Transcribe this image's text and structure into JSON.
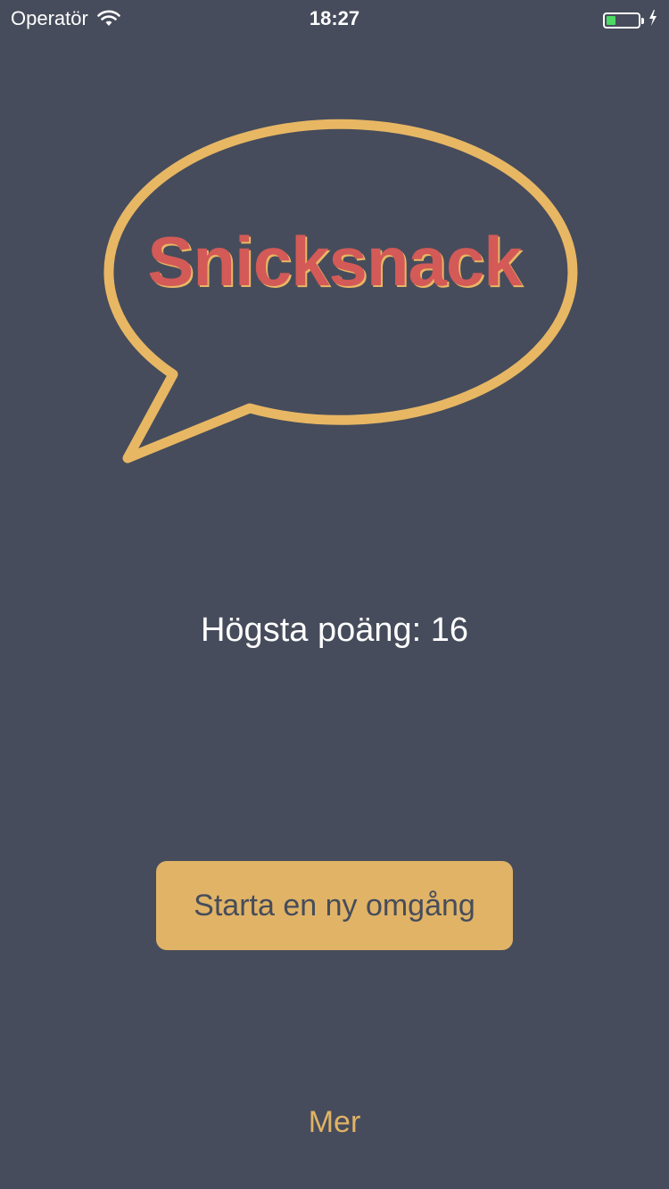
{
  "status_bar": {
    "carrier": "Operatör",
    "time": "18:27",
    "battery_level": 0.28,
    "battery_color": "#4cd964",
    "charging": true,
    "wifi_icon": "wifi-icon",
    "charging_icon": "bolt-icon"
  },
  "logo": {
    "title": "Snicksnack",
    "bubble_icon": "speech-bubble-icon"
  },
  "high_score": "Högsta poäng: 16",
  "start_button": {
    "label": "Starta en ny omgång"
  },
  "more_link": {
    "label": "Mer"
  },
  "colors": {
    "background": "#464c5b",
    "accent": "#e0b366",
    "title": "#d35a57",
    "bubble_outline": "#e8b764"
  }
}
